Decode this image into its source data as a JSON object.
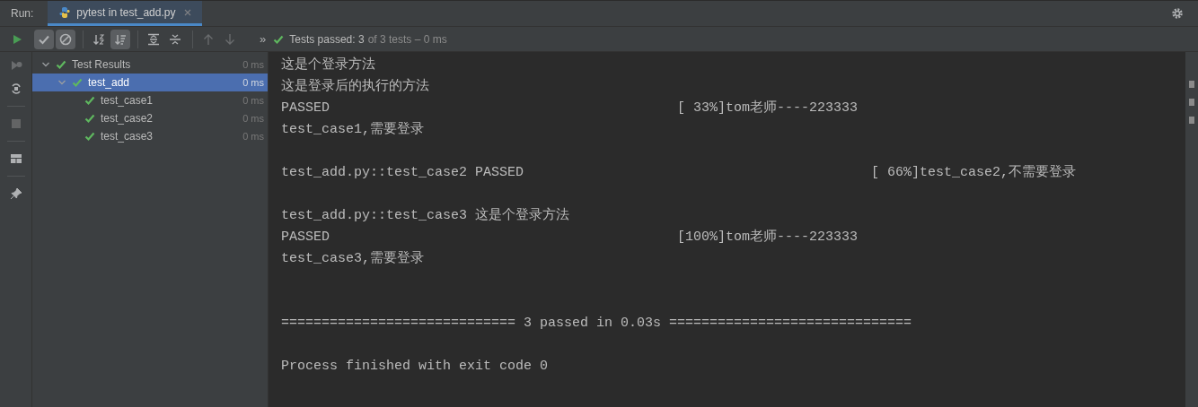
{
  "header": {
    "label": "Run:",
    "tab": {
      "title": "pytest in test_add.py",
      "selected": true
    }
  },
  "toolbar": {
    "buttons": [
      {
        "kind": "run",
        "selected": false,
        "disabled": false
      },
      {
        "kind": "show-passed",
        "selected": true,
        "disabled": false
      },
      {
        "kind": "show-ignored",
        "selected": true,
        "disabled": false
      },
      {
        "kind": "sort-alpha",
        "selected": false,
        "disabled": false
      },
      {
        "kind": "sort-duration",
        "selected": true,
        "disabled": false
      },
      {
        "kind": "expand-all",
        "selected": false,
        "disabled": false
      },
      {
        "kind": "collapse-all",
        "selected": false,
        "disabled": false
      },
      {
        "kind": "previous",
        "selected": false,
        "disabled": true
      },
      {
        "kind": "next",
        "selected": false,
        "disabled": true
      }
    ],
    "overflow": "»",
    "status": {
      "passed": true,
      "label": "Tests passed:",
      "count": "3",
      "detail": "of 3 tests – 0 ms"
    }
  },
  "tree": [
    {
      "label": "Test Results",
      "time": "0 ms",
      "passed": true,
      "expanded": true,
      "selected": false,
      "children": [
        {
          "label": "test_add",
          "time": "0 ms",
          "passed": true,
          "expanded": true,
          "selected": true,
          "children": [
            {
              "label": "test_case1",
              "time": "0 ms",
              "passed": true,
              "selected": false
            },
            {
              "label": "test_case2",
              "time": "0 ms",
              "passed": true,
              "selected": false
            },
            {
              "label": "test_case3",
              "time": "0 ms",
              "passed": true,
              "selected": false
            }
          ]
        }
      ]
    }
  ],
  "console": [
    {
      "kind": "plain",
      "text": "这是个登录方法"
    },
    {
      "kind": "plain",
      "text": "这是登录后的执行的方法"
    },
    {
      "kind": "status",
      "text": "PASSED",
      "progress": "[ 33%]tom老师----223333"
    },
    {
      "kind": "plain",
      "text": "test_case1,需要登录"
    },
    {
      "kind": "blank"
    },
    {
      "kind": "node",
      "text": "test_add.py::test_case2 PASSED",
      "progress": "[ 66%]test_case2,不需要登录"
    },
    {
      "kind": "blank"
    },
    {
      "kind": "plain",
      "text": "test_add.py::test_case3 这是个登录方法"
    },
    {
      "kind": "status",
      "text": "PASSED",
      "progress": "[100%]tom老师----223333"
    },
    {
      "kind": "plain",
      "text": "test_case3,需要登录"
    },
    {
      "kind": "blank"
    },
    {
      "kind": "blank"
    },
    {
      "kind": "plain",
      "text": "============================= 3 passed in 0.03s =============================="
    },
    {
      "kind": "blank"
    },
    {
      "kind": "plain",
      "text": "Process finished with exit code 0"
    }
  ]
}
